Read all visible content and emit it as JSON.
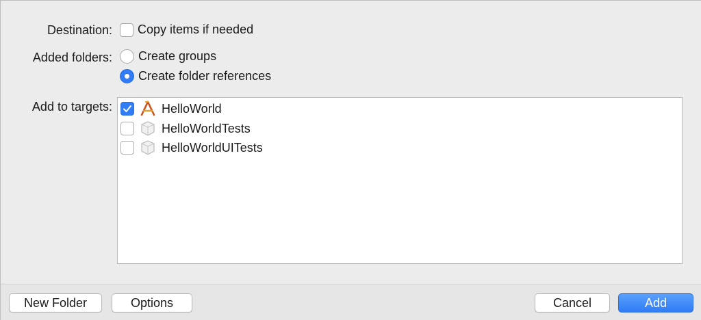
{
  "destination": {
    "label": "Destination:",
    "option_label": "Copy items if needed",
    "checked": false
  },
  "added_folders": {
    "label": "Added folders:",
    "options": [
      {
        "label": "Create groups",
        "selected": false
      },
      {
        "label": "Create folder references",
        "selected": true
      }
    ]
  },
  "targets": {
    "label": "Add to targets:",
    "items": [
      {
        "name": "HelloWorld",
        "checked": true,
        "icon": "app-target-icon"
      },
      {
        "name": "HelloWorldTests",
        "checked": false,
        "icon": "test-bundle-icon"
      },
      {
        "name": "HelloWorldUITests",
        "checked": false,
        "icon": "test-bundle-icon"
      }
    ]
  },
  "footer": {
    "new_folder": "New Folder",
    "options": "Options",
    "cancel": "Cancel",
    "add": "Add"
  },
  "colors": {
    "accent": "#2f7cf6",
    "background": "#ececec"
  }
}
